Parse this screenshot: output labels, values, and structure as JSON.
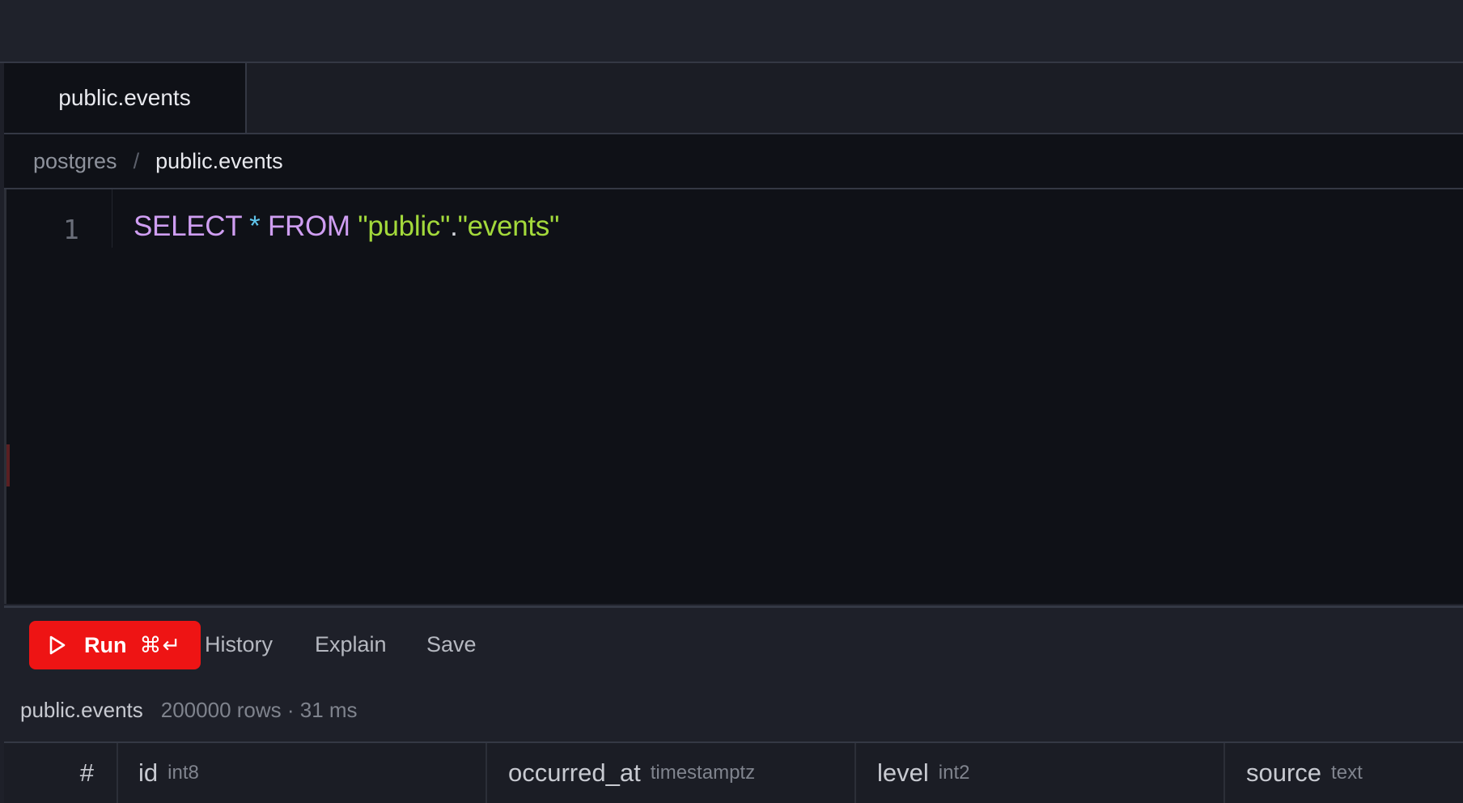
{
  "tabs": [
    {
      "label": "public.events"
    }
  ],
  "breadcrumb": {
    "root": "postgres",
    "separator": "/",
    "current": "public.events"
  },
  "editor": {
    "line_number": "1",
    "code": {
      "select": "SELECT",
      "star": "*",
      "from": "FROM",
      "schema": "\"public\"",
      "dot": ".",
      "table": "\"events\""
    }
  },
  "toolbar": {
    "run_label": "Run",
    "run_shortcut": "⌘↵",
    "history_label": "History",
    "explain_label": "Explain",
    "save_label": "Save"
  },
  "status": {
    "table": "public.events",
    "meta": "200000 rows · 31 ms"
  },
  "grid": {
    "row_number_header": "#",
    "columns": [
      {
        "name": "id",
        "type": "int8"
      },
      {
        "name": "occurred_at",
        "type": "timestamptz"
      },
      {
        "name": "level",
        "type": "int2"
      },
      {
        "name": "source",
        "type": "text"
      }
    ]
  },
  "colors": {
    "accent": "#ee1414",
    "keyword": "#cf9ef2",
    "string": "#a3d93b",
    "operator": "#5fc4ea"
  },
  "icons": {
    "run": "play-icon"
  }
}
